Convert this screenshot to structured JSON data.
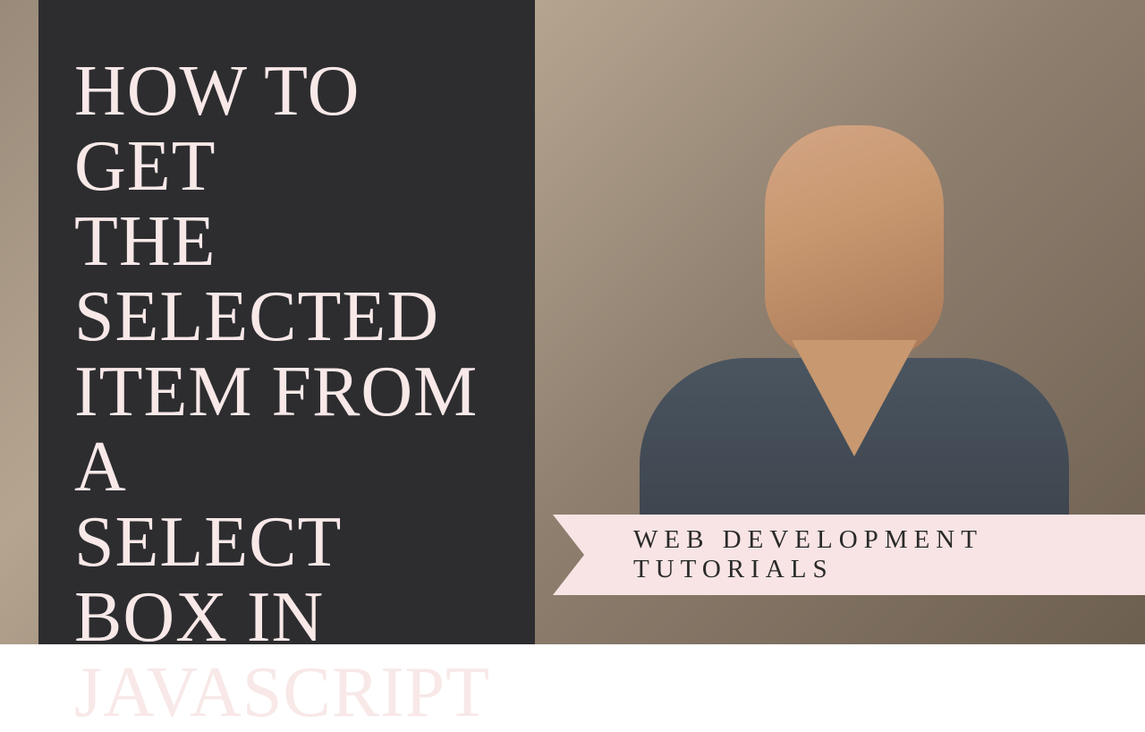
{
  "thumbnail": {
    "title": "HOW TO GET\nTHE SELECTED\nITEM FROM A\nSELECT BOX IN\nJAVASCRIPT",
    "banner_text": "WEB DEVELOPMENT TUTORIALS"
  },
  "colors": {
    "panel_bg": "#2d2d30",
    "title_text": "#f8e8e8",
    "ribbon_bg": "#f8e4e4",
    "ribbon_text": "#2a2a2a"
  }
}
